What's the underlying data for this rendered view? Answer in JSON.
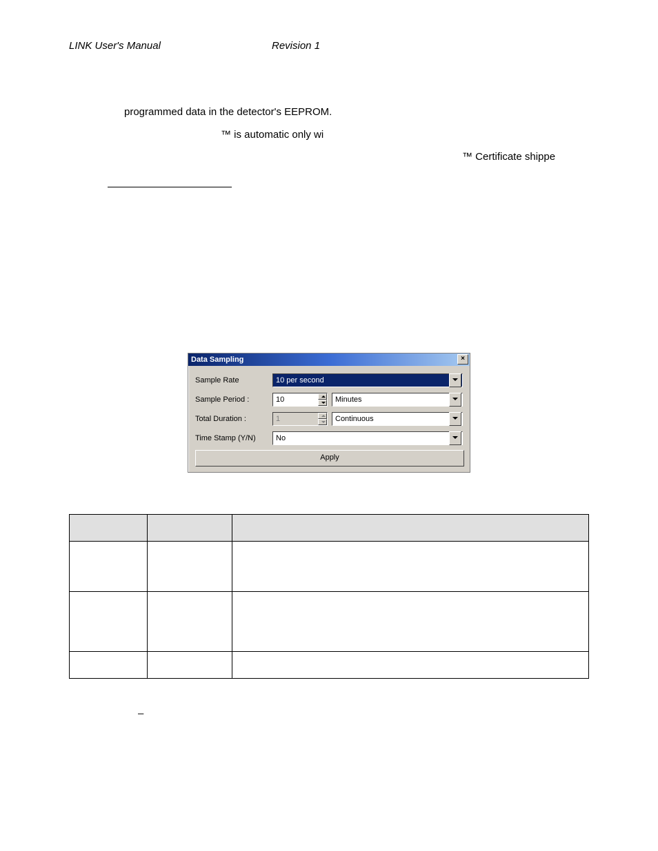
{
  "header": {
    "left": "LINK  User's Manual",
    "center": "Revision  1"
  },
  "body": {
    "line1": "programmed data in the detector's EEPROM.",
    "line2": "™ is automatic only wi",
    "line3": "™ Certificate shippe"
  },
  "dialog": {
    "title": "Data Sampling",
    "fields": {
      "sampleRate": {
        "label": "Sample Rate",
        "value": "10 per second"
      },
      "samplePeriod": {
        "label": "Sample Period :",
        "value": "10",
        "unit": "Minutes"
      },
      "totalDuration": {
        "label": "Total Duration :",
        "value": "1",
        "unit": "Continuous"
      },
      "timeStamp": {
        "label": "Time Stamp (Y/N)",
        "value": "No"
      }
    },
    "applyLabel": "Apply"
  },
  "footer": {
    "dash": "–"
  }
}
